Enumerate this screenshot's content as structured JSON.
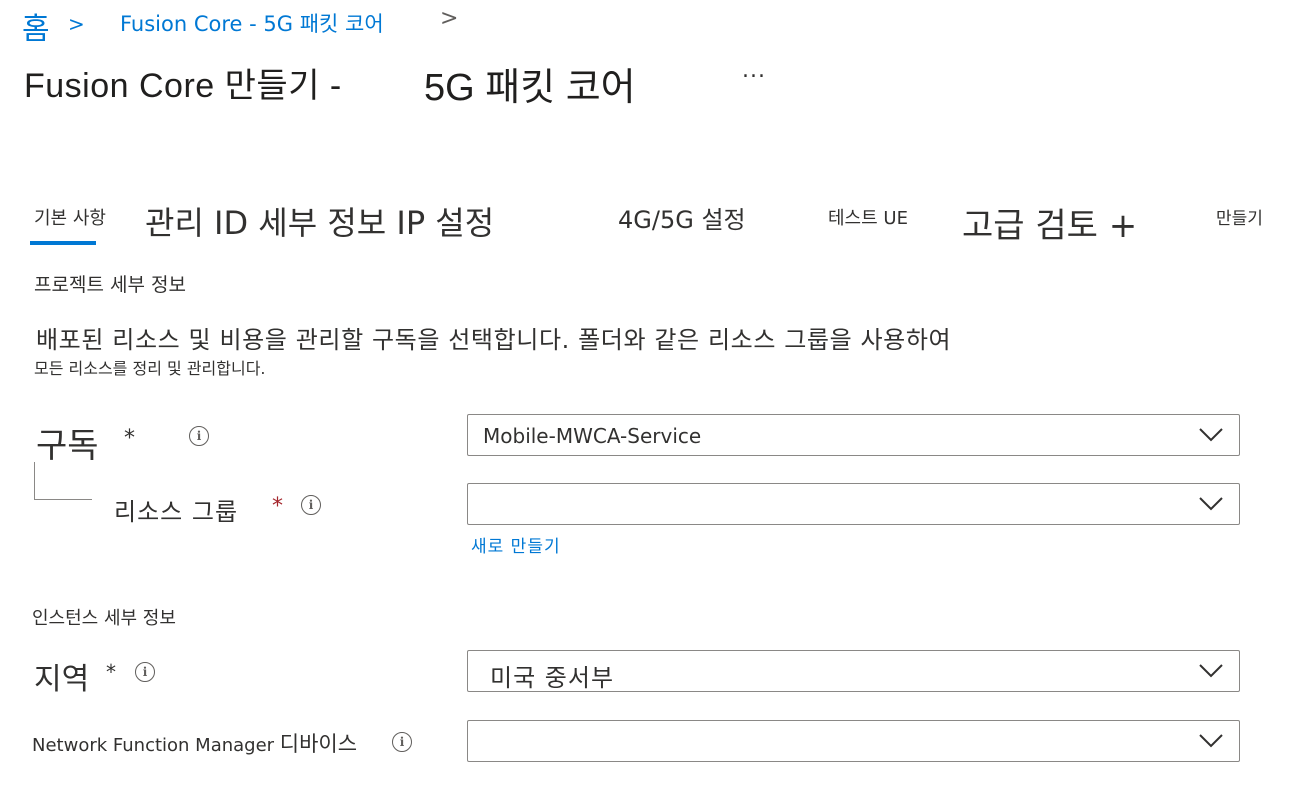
{
  "breadcrumb": {
    "home": "홈",
    "separator": ">",
    "item": "Fusion Core -  5G 패킷 코어",
    "chevron": ">"
  },
  "title": {
    "part1": "Fusion  Core 만들기 -",
    "part2": "5G 패킷 코어",
    "more": "..."
  },
  "tabs": [
    {
      "label": "기본 사항",
      "active": true
    },
    {
      "label": "관리 ID 세부 정보 IP 설정"
    },
    {
      "label": "4G/5G 설정"
    },
    {
      "label": "테스트 UE"
    },
    {
      "label": "고급 검토 +"
    },
    {
      "label": "만들기"
    }
  ],
  "project": {
    "heading": "프로젝트 세부 정보",
    "description_line1": "배포된 리소스 및 비용을 관리할 구독을 선택합니다. 폴더와 같은 리소스 그룹을 사용하여",
    "description_line2": "모든 리소스를 정리 및 관리합니다.",
    "subscription_label": "구독",
    "subscription_required": "*",
    "subscription_value": "Mobile-MWCA-Service",
    "resource_group_label": "리소스 그룹",
    "resource_group_required": "*",
    "resource_group_value": "",
    "create_new": "새로 만들기"
  },
  "instance": {
    "heading": "인스턴스 세부 정보",
    "region_label": "지역",
    "region_required": "*",
    "region_value": "미국 중서부",
    "nfm_label_en": "Network  Function  Manager",
    "nfm_label_ko": "디바이스",
    "nfm_value": ""
  },
  "icons": {
    "info": "i",
    "chevron": "chevron-down-icon"
  },
  "colors": {
    "accent": "#0078d4",
    "required": "#a4262c",
    "border": "#8a8886",
    "text": "#323130"
  }
}
